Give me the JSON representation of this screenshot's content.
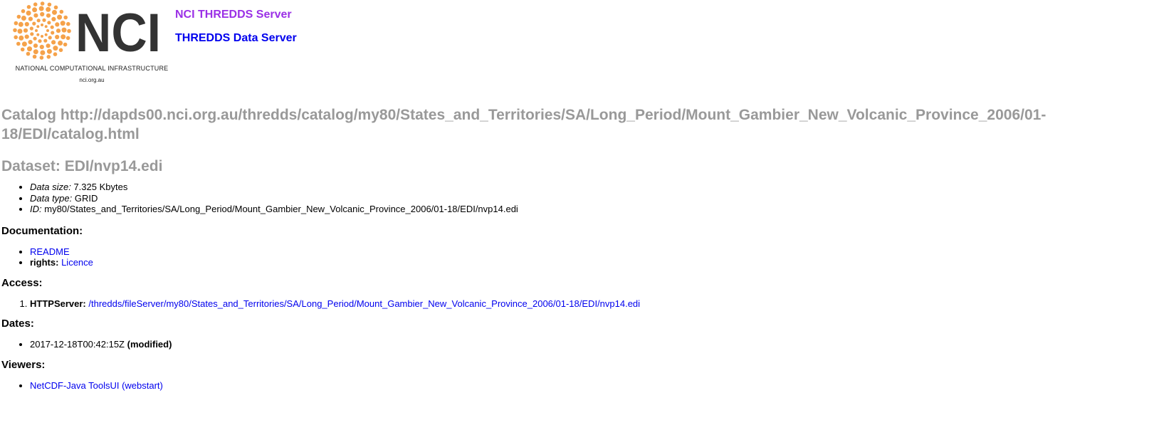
{
  "header": {
    "logo_text": "NCI",
    "logo_name": "NATIONAL COMPUTATIONAL INFRASTRUCTURE",
    "logo_url": "nci.org.au",
    "server_title": "NCI THREDDS Server",
    "server_subtitle": "THREDDS Data Server",
    "colors": {
      "logo_dots": "#f5a24a",
      "logo_text": "#333333",
      "server_title": "#9b30e6",
      "link": "#0000ee",
      "heading_gray": "#999999"
    }
  },
  "catalog": {
    "heading": "Catalog http://dapds00.nci.org.au/thredds/catalog/my80/States_and_Territories/SA/Long_Period/Mount_Gambier_New_Volcanic_Province_2006/01-18/EDI/catalog.html"
  },
  "dataset": {
    "heading": "Dataset: EDI/nvp14.edi",
    "properties": [
      {
        "label": "Data size:",
        "value": "7.325 Kbytes"
      },
      {
        "label": "Data type:",
        "value": "GRID"
      },
      {
        "label": "ID:",
        "value": "my80/States_and_Territories/SA/Long_Period/Mount_Gambier_New_Volcanic_Province_2006/01-18/EDI/nvp14.edi"
      }
    ]
  },
  "documentation": {
    "heading": "Documentation:",
    "readme_link": "README",
    "rights_label": "rights:",
    "rights_link": "Licence"
  },
  "access": {
    "heading": "Access:",
    "service_label": "HTTPServer:",
    "service_link": "/thredds/fileServer/my80/States_and_Territories/SA/Long_Period/Mount_Gambier_New_Volcanic_Province_2006/01-18/EDI/nvp14.edi"
  },
  "dates": {
    "heading": "Dates:",
    "date_value": "2017-12-18T00:42:15Z",
    "date_type": "(modified)"
  },
  "viewers": {
    "heading": "Viewers:",
    "viewer_link": "NetCDF-Java ToolsUI (webstart)"
  }
}
